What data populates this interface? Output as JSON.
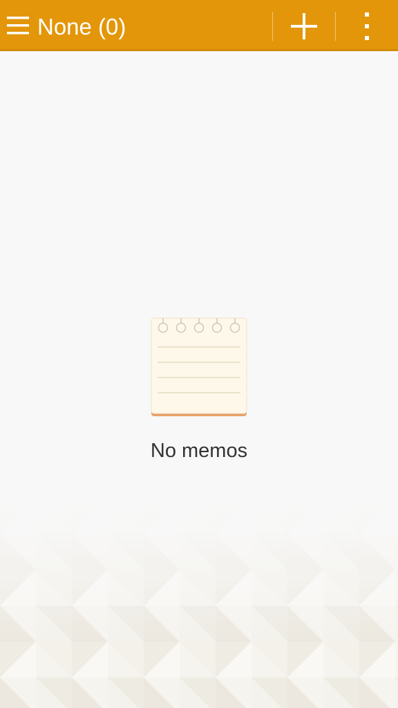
{
  "header": {
    "title": "None (0)",
    "menu_icon": "hamburger-menu-icon",
    "add_icon": "plus-icon",
    "more_icon": "overflow-menu-icon"
  },
  "empty_state": {
    "icon": "notepad-icon",
    "message": "No memos"
  },
  "colors": {
    "accent": "#e3960a",
    "background": "#f8f8f8",
    "text": "#333333"
  }
}
